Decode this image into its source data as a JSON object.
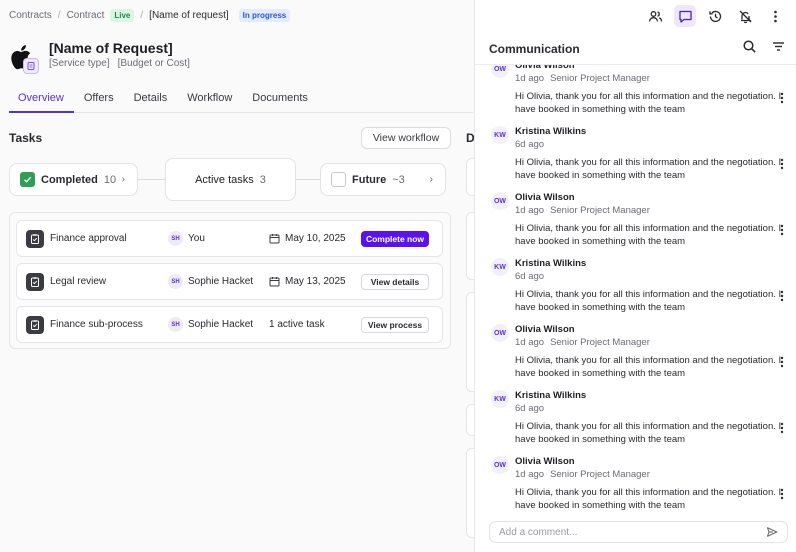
{
  "breadcrumb": {
    "items": [
      "Contracts",
      "Contract"
    ],
    "badge_live": "Live",
    "current": "[Name of request]",
    "status": "In progress"
  },
  "header": {
    "title": "[Name of Request]",
    "service_type": "[Service type]",
    "budget": "[Budget or Cost]"
  },
  "tabs": [
    {
      "label": "Overview",
      "active": true
    },
    {
      "label": "Offers"
    },
    {
      "label": "Details"
    },
    {
      "label": "Workflow"
    },
    {
      "label": "Documents"
    }
  ],
  "tasks": {
    "heading": "Tasks",
    "view_workflow_label": "View workflow",
    "stages": {
      "completed": {
        "label": "Completed",
        "count": "10"
      },
      "active": {
        "label": "Active tasks",
        "count": "3"
      },
      "future": {
        "label": "Future",
        "count": "~3"
      }
    },
    "rows": [
      {
        "name": "Finance approval",
        "avatar": "SH",
        "assignee": "You",
        "date": "May 10, 2025",
        "action": "Complete now"
      },
      {
        "name": "Legal review",
        "avatar": "SH",
        "assignee": "Sophie Hacket",
        "date": "May 13, 2025",
        "action": "View details"
      },
      {
        "name": "Finance sub-process",
        "avatar": "SH",
        "assignee": "Sophie Hacket",
        "date": "1 active task",
        "action": "View process"
      }
    ]
  },
  "side_heading_letter": "D",
  "communication": {
    "heading": "Communication",
    "comment_placeholder": "Add a comment...",
    "messages": [
      {
        "avatar": "OW",
        "name": "Olivia Wilson",
        "time": "1d ago",
        "role": "Senior Project Manager",
        "text": "Hi Olivia, thank you for all this information and the negotiation. I have booked in something with the team"
      },
      {
        "avatar": "KW",
        "name": "Kristina Wilkins",
        "time": "6d ago",
        "role": "",
        "text": "Hi Olivia, thank you for all this information and the negotiation. I have booked in something with the team"
      },
      {
        "avatar": "OW",
        "name": "Olivia Wilson",
        "time": "1d ago",
        "role": "Senior Project Manager",
        "text": "Hi Olivia, thank you for all this information and the negotiation. I have booked in something with the team"
      },
      {
        "avatar": "KW",
        "name": "Kristina Wilkins",
        "time": "6d ago",
        "role": "",
        "text": "Hi Olivia, thank you for all this information and the negotiation. I have booked in something with the team"
      },
      {
        "avatar": "OW",
        "name": "Olivia Wilson",
        "time": "1d ago",
        "role": "Senior Project Manager",
        "text": "Hi Olivia, thank you for all this information and the negotiation. I have booked in something with the team"
      },
      {
        "avatar": "KW",
        "name": "Kristina Wilkins",
        "time": "6d ago",
        "role": "",
        "text": "Hi Olivia, thank you for all this information and the negotiation. I have booked in something with the team"
      },
      {
        "avatar": "OW",
        "name": "Olivia Wilson",
        "time": "1d ago",
        "role": "Senior Project Manager",
        "text": "Hi Olivia, thank you for all this information and the negotiation. I have booked in something with the team"
      }
    ]
  },
  "colors": {
    "accent": "#5b12f2",
    "live_bg": "#dcf5e3",
    "progress_bg": "#e3ebff",
    "completed_green": "#2f9e57"
  }
}
